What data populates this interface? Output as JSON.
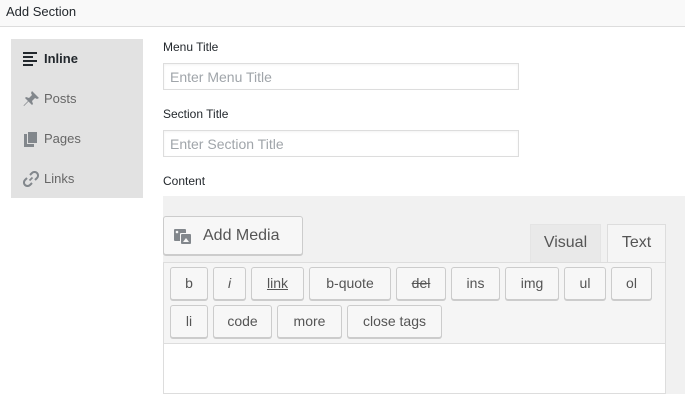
{
  "header": {
    "title": "Add Section"
  },
  "sidebar": {
    "items": [
      {
        "label": "Inline",
        "icon": "align-left-icon",
        "active": true
      },
      {
        "label": "Posts",
        "icon": "pin-icon"
      },
      {
        "label": "Pages",
        "icon": "pages-icon"
      },
      {
        "label": "Links",
        "icon": "link-icon"
      }
    ]
  },
  "form": {
    "menu_title": {
      "label": "Menu Title",
      "placeholder": "Enter Menu Title",
      "value": ""
    },
    "section_title": {
      "label": "Section Title",
      "placeholder": "Enter Section Title",
      "value": ""
    },
    "content": {
      "label": "Content"
    }
  },
  "editor": {
    "add_media_label": "Add Media",
    "tabs": {
      "visual": "Visual",
      "text": "Text",
      "active": "Text"
    },
    "quicktags": [
      "b",
      "i",
      "link",
      "b-quote",
      "del",
      "ins",
      "img",
      "ul",
      "ol",
      "li",
      "code",
      "more",
      "close tags"
    ]
  },
  "colors": {
    "sidebar_bg": "#e2e2e2",
    "editor_bg": "#f1f1f1",
    "button_bg": "#f7f7f7"
  }
}
